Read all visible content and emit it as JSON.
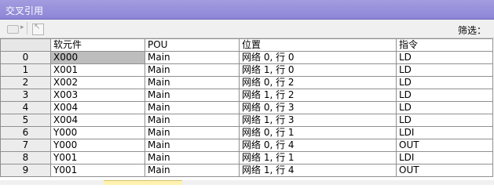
{
  "window": {
    "title": "交叉引用"
  },
  "toolbar": {
    "filter_label": "筛选："
  },
  "table": {
    "columns": [
      "软元件",
      "POU",
      "位置",
      "指令"
    ],
    "rows": [
      {
        "index": "0",
        "device": "X000",
        "pou": "Main",
        "position": "网络 0, 行 0",
        "instruction": "LD"
      },
      {
        "index": "1",
        "device": "X001",
        "pou": "Main",
        "position": "网络 1, 行 0",
        "instruction": "LD"
      },
      {
        "index": "2",
        "device": "X002",
        "pou": "Main",
        "position": "网络 0, 行 2",
        "instruction": "LD"
      },
      {
        "index": "3",
        "device": "X003",
        "pou": "Main",
        "position": "网络 1, 行 2",
        "instruction": "LD"
      },
      {
        "index": "4",
        "device": "X004",
        "pou": "Main",
        "position": "网络 0, 行 3",
        "instruction": "LD"
      },
      {
        "index": "5",
        "device": "X004",
        "pou": "Main",
        "position": "网络 1, 行 3",
        "instruction": "LD"
      },
      {
        "index": "6",
        "device": "Y000",
        "pou": "Main",
        "position": "网络 0, 行 1",
        "instruction": "LDI"
      },
      {
        "index": "7",
        "device": "Y000",
        "pou": "Main",
        "position": "网络 0, 行 4",
        "instruction": "OUT"
      },
      {
        "index": "8",
        "device": "Y001",
        "pou": "Main",
        "position": "网络 1, 行 1",
        "instruction": "LDI"
      },
      {
        "index": "9",
        "device": "Y001",
        "pou": "Main",
        "position": "网络 1, 行 4",
        "instruction": "OUT"
      }
    ],
    "selected_row": 0
  },
  "icons": [
    "list-icon",
    "dropdown-arrow-icon",
    "jump-to-icon"
  ]
}
